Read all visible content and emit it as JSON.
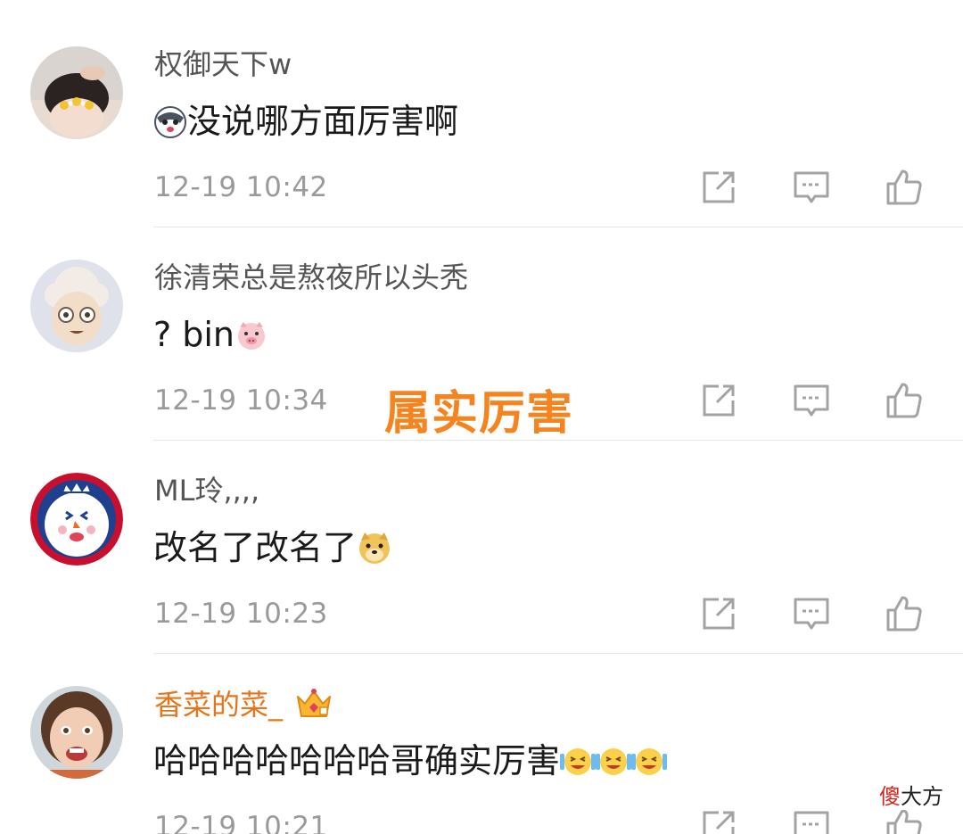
{
  "comments": [
    {
      "username": "权御天下w",
      "text": "没说哪方面厉害啊",
      "time": "12-19 10:42",
      "avatar": "girl-with-flower-crown",
      "emoji_before": "husky-dog-emoji"
    },
    {
      "username": "徐清荣总是熬夜所以头秃",
      "text": "? bin",
      "time": "12-19 10:34",
      "avatar": "cartoon-sheep",
      "emoji_after": "pig-emoji"
    },
    {
      "username": "ML玲,,,,",
      "text": "改名了改名了",
      "time": "12-19 10:23",
      "avatar": "cartoon-clown-mascot",
      "emoji_after": "doge-emoji"
    },
    {
      "username": "香菜的菜_",
      "text": "哈哈哈哈哈哈哈哥确实厉害",
      "time": "12-19 10:21",
      "avatar": "child-face-photo",
      "vip": true,
      "badge": "crown-icon",
      "emoji_after": [
        "laugh-cry-emoji",
        "laugh-cry-emoji",
        "laugh-cry-emoji"
      ]
    }
  ],
  "actions": {
    "share_icon": "share-icon",
    "reply_icon": "comment-icon",
    "like_icon": "thumbs-up-icon"
  },
  "overlay_text": "属实厉害",
  "watermark": {
    "red_char": "傻",
    "rest": "大方"
  },
  "colors": {
    "username": "#555555",
    "vip_username": "#e8741a",
    "overlay": "#f5841e",
    "time": "#9a9a9a",
    "icon": "#a3a3a3"
  }
}
